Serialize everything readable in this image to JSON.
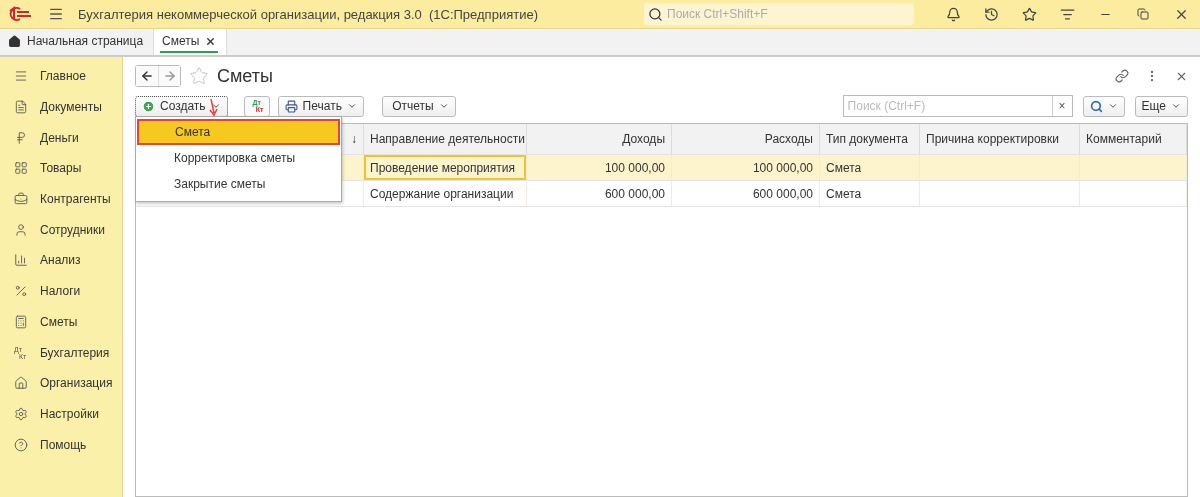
{
  "window": {
    "title": "Бухгалтерия некоммерческой организации, редакция 3.0  (1С:Предприятие)",
    "search_placeholder": "Поиск Ctrl+Shift+F"
  },
  "tabs": [
    {
      "label": "Начальная страница",
      "selected": false
    },
    {
      "label": "Сметы",
      "selected": true
    }
  ],
  "sidebar": {
    "items": [
      {
        "label": "Главное"
      },
      {
        "label": "Документы"
      },
      {
        "label": "Деньги"
      },
      {
        "label": "Товары"
      },
      {
        "label": "Контрагенты"
      },
      {
        "label": "Сотрудники"
      },
      {
        "label": "Анализ"
      },
      {
        "label": "Налоги"
      },
      {
        "label": "Сметы"
      },
      {
        "label": "Бухгалтерия",
        "icon_text": [
          "Дт",
          "Кт"
        ]
      },
      {
        "label": "Организация"
      },
      {
        "label": "Настройки"
      },
      {
        "label": "Помощь"
      }
    ]
  },
  "form": {
    "title": "Сметы",
    "favorite": false,
    "toolbar": {
      "create": "Создать",
      "dtkt": [
        "Дт",
        "Кт"
      ],
      "print": "Печать",
      "reports": "Отчеты",
      "search_placeholder": "Поиск (Ctrl+F)",
      "clear": "×",
      "more": "Еще"
    },
    "create_menu": [
      {
        "label": "Смета",
        "selected": true
      },
      {
        "label": "Корректировка сметы",
        "selected": false
      },
      {
        "label": "Закрытие сметы",
        "selected": false
      }
    ],
    "table": {
      "columns": [
        {
          "label": "↓"
        },
        {
          "label": "Направление деятельности"
        },
        {
          "label": "Доходы"
        },
        {
          "label": "Расходы"
        },
        {
          "label": "Тип документа"
        },
        {
          "label": "Причина корректировки"
        },
        {
          "label": "Комментарий"
        }
      ],
      "rows": [
        {
          "selected": true,
          "cells": [
            null,
            {
              "text": "Проведение мероприятия",
              "focused": true
            },
            {
              "text": "100 000,00",
              "focused": false
            },
            {
              "text": "100 000,00",
              "focused": false
            },
            {
              "text": "Смета",
              "focused": false
            },
            null,
            null
          ]
        },
        {
          "selected": false,
          "cells": [
            null,
            {
              "text": "Содержание организации",
              "focused": false
            },
            {
              "text": "600 000,00",
              "focused": false
            },
            {
              "text": "600 000,00",
              "focused": false
            },
            {
              "text": "Смета",
              "focused": false
            },
            null,
            null
          ]
        }
      ]
    }
  }
}
